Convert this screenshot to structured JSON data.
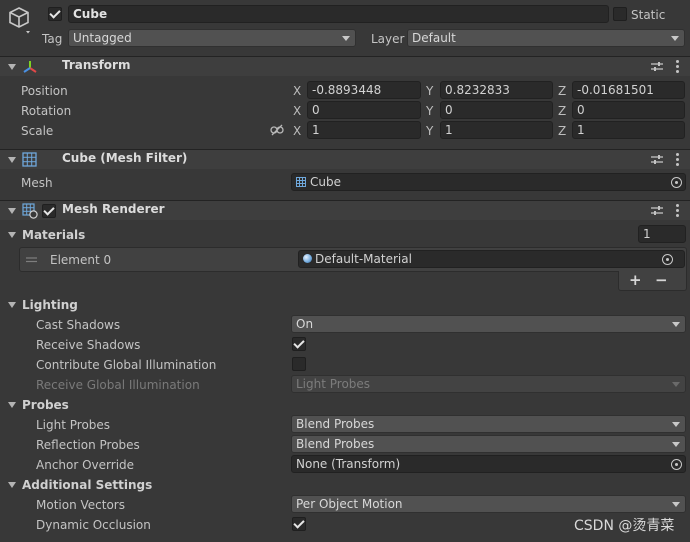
{
  "object": {
    "name": "Cube",
    "static_label": "Static",
    "tag_label": "Tag",
    "tag_value": "Untagged",
    "layer_label": "Layer",
    "layer_value": "Default"
  },
  "transform": {
    "title": "Transform",
    "rows": [
      {
        "label": "Position",
        "x": "-0.8893448",
        "y": "0.8232833",
        "z": "-0.01681501"
      },
      {
        "label": "Rotation",
        "x": "0",
        "y": "0",
        "z": "0"
      },
      {
        "label": "Scale",
        "x": "1",
        "y": "1",
        "z": "1"
      }
    ],
    "axes": {
      "x": "X",
      "y": "Y",
      "z": "Z"
    }
  },
  "mesh_filter": {
    "title": "Cube (Mesh Filter)",
    "mesh_label": "Mesh",
    "mesh_value": "Cube"
  },
  "mesh_renderer": {
    "title": "Mesh Renderer",
    "materials_label": "Materials",
    "materials_count": "1",
    "element_label": "Element 0",
    "element_value": "Default-Material",
    "add_label": "+",
    "remove_label": "−",
    "lighting": {
      "title": "Lighting",
      "cast_shadows_label": "Cast Shadows",
      "cast_shadows_value": "On",
      "receive_shadows_label": "Receive Shadows",
      "contribute_gi_label": "Contribute Global Illumination",
      "receive_gi_label": "Receive Global Illumination",
      "receive_gi_value": "Light Probes"
    },
    "probes": {
      "title": "Probes",
      "light_probes_label": "Light Probes",
      "light_probes_value": "Blend Probes",
      "reflection_probes_label": "Reflection Probes",
      "reflection_probes_value": "Blend Probes",
      "anchor_label": "Anchor Override",
      "anchor_value": "None (Transform)"
    },
    "additional": {
      "title": "Additional Settings",
      "motion_vectors_label": "Motion Vectors",
      "motion_vectors_value": "Per Object Motion",
      "dynamic_occlusion_label": "Dynamic Occlusion"
    }
  },
  "watermark": "CSDN @烫青菜",
  "colors": {
    "background": "#383838",
    "header": "#3e3e3e",
    "field": "#2a2a2a",
    "dropdown": "#515151",
    "material_sphere": "#6fa8dc"
  }
}
